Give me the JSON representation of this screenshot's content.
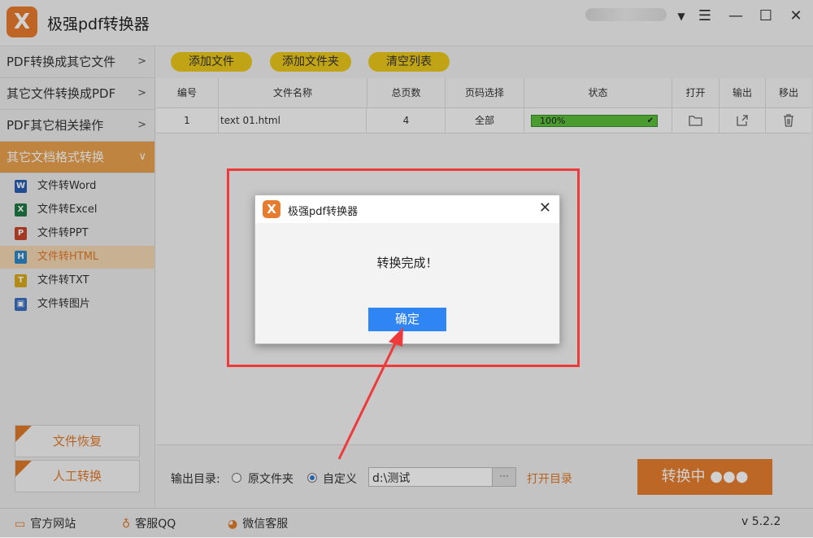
{
  "app": {
    "title": "极强pdf转换器",
    "version": "v 5.2.2",
    "logo_glyph": "X"
  },
  "sidebar": {
    "categories": [
      {
        "label": "PDF转换成其它文件",
        "arrow": ">"
      },
      {
        "label": "其它文件转换成PDF",
        "arrow": ">"
      },
      {
        "label": "PDF其它相关操作",
        "arrow": ">"
      },
      {
        "label": "其它文档格式转换",
        "arrow": "∨"
      }
    ],
    "items": [
      {
        "label": "文件转Word",
        "icon": "word-icon",
        "color": "#2b5fb4",
        "glyph": "W"
      },
      {
        "label": "文件转Excel",
        "icon": "excel-icon",
        "color": "#1e7b45",
        "glyph": "X"
      },
      {
        "label": "文件转PPT",
        "icon": "ppt-icon",
        "color": "#c9462b",
        "glyph": "P"
      },
      {
        "label": "文件转HTML",
        "icon": "html-icon",
        "color": "#2f88c8",
        "glyph": "H"
      },
      {
        "label": "文件转TXT",
        "icon": "txt-icon",
        "color": "#d9a91b",
        "glyph": "T"
      },
      {
        "label": "文件转图片",
        "icon": "image-icon",
        "color": "#3b6fc0",
        "glyph": "▣"
      }
    ],
    "recover_label": "文件恢复",
    "manual_label": "人工转换"
  },
  "toolbar": {
    "add_file": "添加文件",
    "add_folder": "添加文件夹",
    "clear_list": "清空列表"
  },
  "table": {
    "columns": [
      "编号",
      "文件名称",
      "总页数",
      "页码选择",
      "状态",
      "打开",
      "输出",
      "移出"
    ],
    "rows": [
      {
        "id": "1",
        "name": "text 01.html",
        "pages": "4",
        "range": "全部",
        "status": "100%",
        "progress": 1.0
      }
    ]
  },
  "output": {
    "label": "输出目录:",
    "option_original": "原文件夹",
    "option_custom": "自定义",
    "selected": "custom",
    "path": "d:\\测试",
    "browse": "···",
    "open_dir": "打开目录"
  },
  "convert_button": "转换中 ●●●",
  "status_bar": {
    "website": "官方网站",
    "qq": "客服QQ",
    "wechat": "微信客服"
  },
  "dialog": {
    "title": "极强pdf转换器",
    "message": "转换完成！",
    "ok": "确定",
    "close": "✕"
  },
  "colors": {
    "accent": "#e87c2e",
    "toolbar_btn": "#ecc91a",
    "ok_button": "#2f85f4",
    "highlight": "#ee3a3a",
    "progress": "#5bbf3c"
  }
}
